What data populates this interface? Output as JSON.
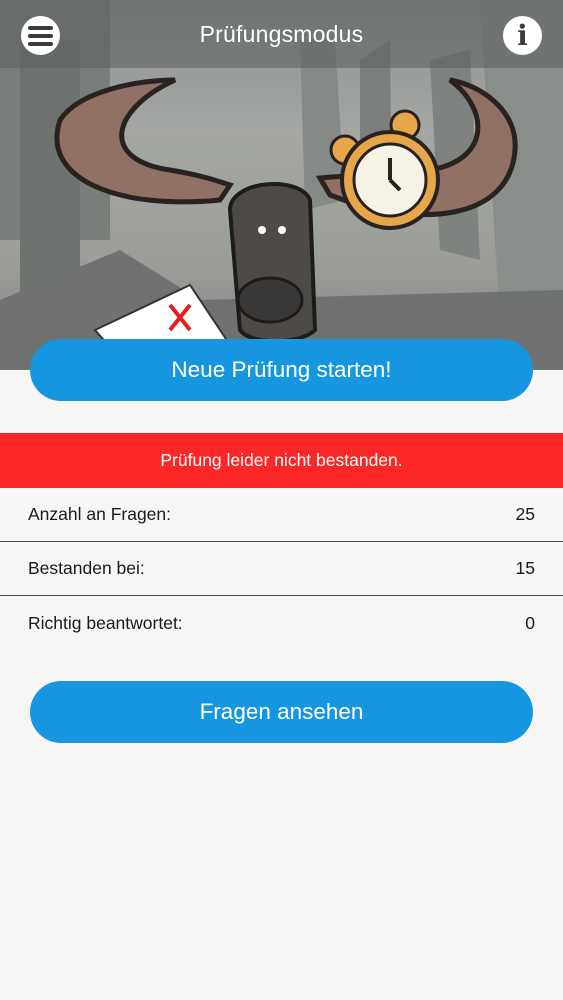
{
  "header": {
    "title": "Prüfungsmodus",
    "menu_icon": "menu-icon",
    "info_icon": "info-icon",
    "info_glyph": "i"
  },
  "hero": {
    "illustration": "horned-monster-with-alarm-clock"
  },
  "actions": {
    "start_label": "Neue Prüfung starten!",
    "review_label": "Fragen ansehen"
  },
  "result": {
    "banner_text": "Prüfung leider nicht bestanden.",
    "banner_color": "#fb2727"
  },
  "stats": [
    {
      "label": "Anzahl an Fragen:",
      "value": "25"
    },
    {
      "label": "Bestanden bei:",
      "value": "15"
    },
    {
      "label": "Richtig beantwortet:",
      "value": "0"
    }
  ],
  "colors": {
    "accent": "#1796e0",
    "background": "#f8f6f4"
  }
}
